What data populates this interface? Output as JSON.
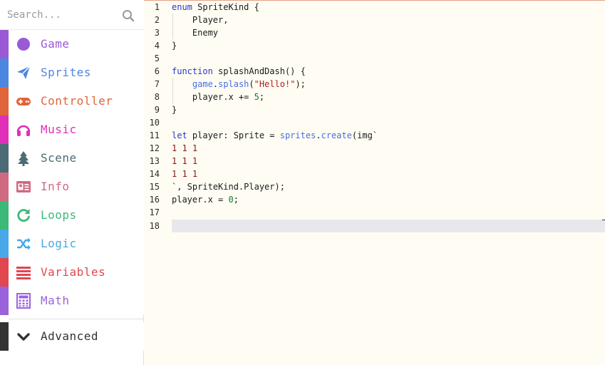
{
  "search": {
    "placeholder": "Search..."
  },
  "categories": [
    {
      "label": "Game",
      "color": "#9a5ad6",
      "icon": "circle-icon"
    },
    {
      "label": "Sprites",
      "color": "#4b87e0",
      "icon": "paper-plane-icon"
    },
    {
      "label": "Controller",
      "color": "#e0653a",
      "icon": "gamepad-icon"
    },
    {
      "label": "Music",
      "color": "#e02fb8",
      "icon": "headphones-icon"
    },
    {
      "label": "Scene",
      "color": "#4b6b75",
      "icon": "tree-icon"
    },
    {
      "label": "Info",
      "color": "#d06a80",
      "icon": "id-card-icon"
    },
    {
      "label": "Loops",
      "color": "#3cb878",
      "icon": "refresh-icon"
    },
    {
      "label": "Logic",
      "color": "#48a8e8",
      "icon": "shuffle-icon"
    },
    {
      "label": "Variables",
      "color": "#e0474f",
      "icon": "list-icon"
    },
    {
      "label": "Math",
      "color": "#9a63dc",
      "icon": "calculator-icon"
    },
    {
      "label": "Advanced",
      "color": "#333333",
      "icon": "chevron-down-icon"
    }
  ],
  "editor": {
    "line_numbers": [
      "1",
      "2",
      "3",
      "4",
      "5",
      "6",
      "7",
      "8",
      "9",
      "10",
      "11",
      "12",
      "13",
      "14",
      "15",
      "16",
      "17",
      "18"
    ],
    "lines": {
      "l1": {
        "a": "enum",
        "b": " SpriteKind {"
      },
      "l2": "    Player,",
      "l3": "    Enemy",
      "l4": "}",
      "l6": {
        "a": "function",
        "b": " splashAndDash() {"
      },
      "l7": {
        "a": "    ",
        "b": "game",
        "c": ".",
        "d": "splash",
        "e": "(",
        "f": "\"Hello!\"",
        "g": ");"
      },
      "l8": {
        "a": "    player.x += ",
        "b": "5",
        "c": ";"
      },
      "l9": "}",
      "l11": {
        "a": "let",
        "b": " player: Sprite = ",
        "c": "sprites",
        "d": ".",
        "e": "create",
        "f": "(img`"
      },
      "l12": "1 1 1",
      "l13": "1 1 1",
      "l14": "1 1 1",
      "l15": "`, SpriteKind.Player);",
      "l16": {
        "a": "player.x = ",
        "b": "0",
        "c": ";"
      }
    }
  }
}
